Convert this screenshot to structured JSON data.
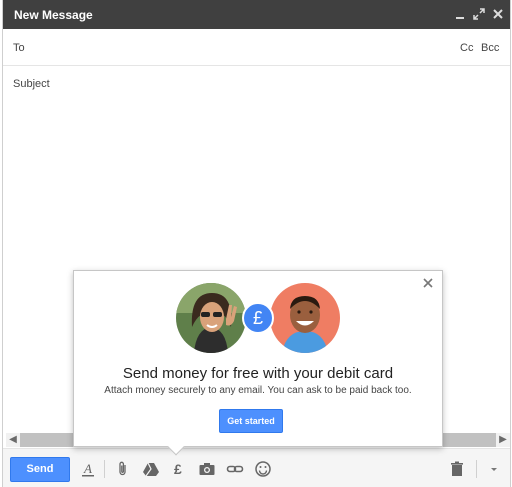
{
  "window": {
    "title": "New Message",
    "controls": [
      "minimize-icon",
      "expand-icon",
      "close-icon"
    ]
  },
  "fields": {
    "to_label": "To",
    "cc": "Cc",
    "bcc": "Bcc",
    "subject_label": "Subject"
  },
  "promo": {
    "title": "Send money for free with your debit card",
    "subtitle": "Attach money securely to any email. You can ask to be paid back too.",
    "button": "Get started",
    "badge": "£"
  },
  "toolbar": {
    "send_label": "Send",
    "money_symbol": "£",
    "icons": [
      "format-text-icon",
      "attach-icon",
      "drive-icon",
      "money-icon",
      "camera-icon",
      "link-icon",
      "emoji-icon",
      "trash-icon",
      "more-options-icon"
    ]
  },
  "colors": {
    "titlebar": "#404040",
    "accent": "#4d90fe",
    "badge": "#4285f4"
  }
}
